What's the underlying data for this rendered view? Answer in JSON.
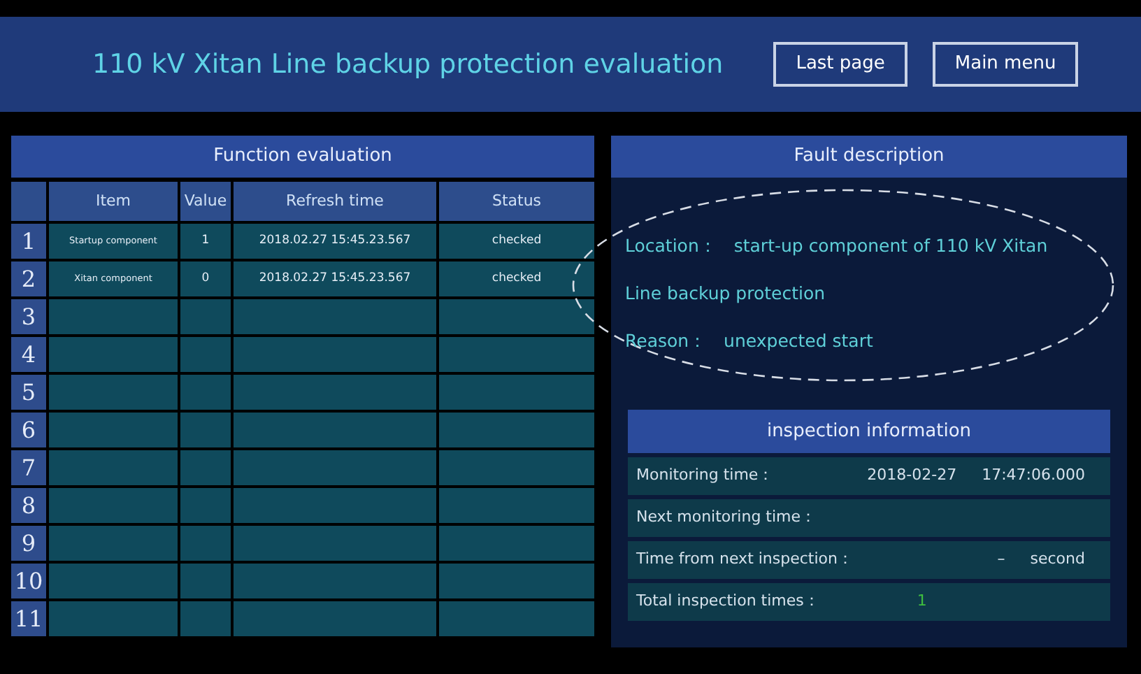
{
  "header": {
    "title": "110 kV Xitan Line backup protection evaluation",
    "buttons": [
      "Last page",
      "Main menu"
    ]
  },
  "function_evaluation": {
    "title": "Function evaluation",
    "columns": [
      "Item",
      "Value",
      "Refresh time",
      "Status"
    ],
    "rows": [
      {
        "number": "1",
        "item": "Startup component",
        "value": "1",
        "refresh_time": "2018.02.27 15:45.23.567",
        "status": "checked"
      },
      {
        "number": "2",
        "item": "Xitan component",
        "value": "0",
        "refresh_time": "2018.02.27 15:45.23.567",
        "status": "checked"
      },
      {
        "number": "3"
      },
      {
        "number": "4"
      },
      {
        "number": "5"
      },
      {
        "number": "6"
      },
      {
        "number": "7"
      },
      {
        "number": "8"
      },
      {
        "number": "9"
      },
      {
        "number": "10"
      },
      {
        "number": "11"
      }
    ]
  },
  "fault_description": {
    "title": "Fault description",
    "lines": [
      {
        "label": "Location：",
        "text": "start-up component of 110 kV Xitan"
      },
      {
        "text": "Line backup  protection"
      },
      {
        "label": "Reason：",
        "text": "unexpected start"
      }
    ]
  },
  "inspection_information": {
    "title": "inspection information",
    "rows": [
      {
        "label": "Monitoring time：",
        "values": [
          "2018-02-27",
          "17:47:06.000"
        ]
      },
      {
        "label": "Next monitoring time："
      },
      {
        "label": "Time from next inspection：",
        "values": [
          "–",
          "second"
        ]
      },
      {
        "label": "Total inspection times：",
        "values": [
          "1"
        ],
        "highlight": true
      }
    ]
  }
}
